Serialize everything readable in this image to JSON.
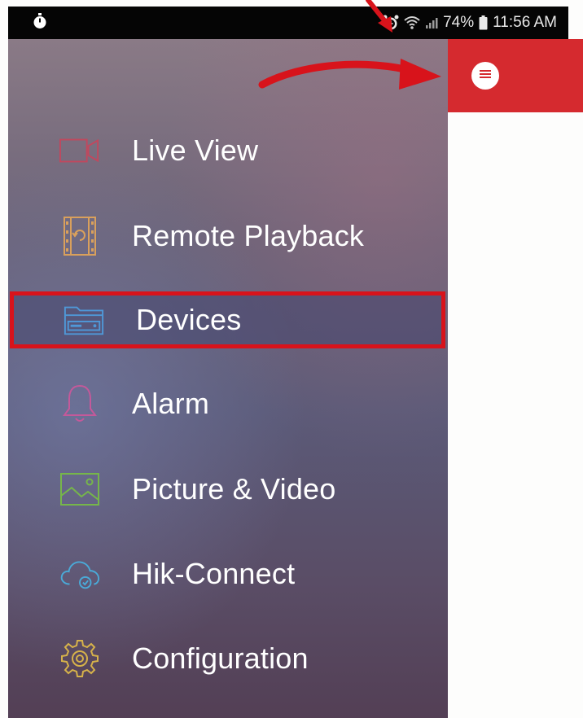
{
  "status_bar": {
    "battery_percent": "74%",
    "time": "11:56 AM",
    "icons": [
      "stopwatch-icon",
      "alarm-icon",
      "wifi-icon",
      "signal-icon",
      "battery-icon"
    ]
  },
  "drawer": {
    "items": [
      {
        "label": "Live View",
        "icon": "video-camera-icon",
        "icon_color": "#c0485e"
      },
      {
        "label": "Remote Playback",
        "icon": "film-playback-icon",
        "icon_color": "#d9a05c"
      },
      {
        "label": "Devices",
        "icon": "device-dvr-icon",
        "icon_color": "#4f98d8",
        "selected": true
      },
      {
        "label": "Alarm",
        "icon": "bell-icon",
        "icon_color": "#c4599a"
      },
      {
        "label": "Picture & Video",
        "icon": "picture-icon",
        "icon_color": "#76b64a"
      },
      {
        "label": "Hik-Connect",
        "icon": "cloud-icon",
        "icon_color": "#4aaad8"
      },
      {
        "label": "Configuration",
        "icon": "gear-icon",
        "icon_color": "#d6b24a"
      }
    ]
  },
  "app_bar": {
    "menu_icon": "menu-icon",
    "background_color": "#d52a2f"
  },
  "annotation": {
    "arrow_color": "#d8131b",
    "highlight_color": "#d8131b"
  }
}
